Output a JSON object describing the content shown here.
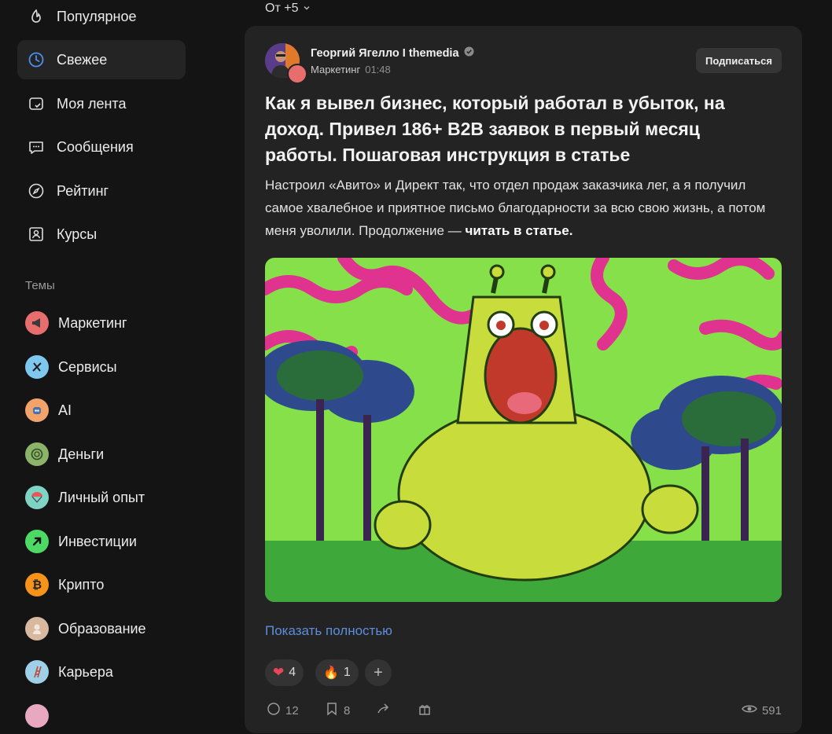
{
  "nav": [
    {
      "label": "Популярное",
      "icon": "fire-icon",
      "active": false
    },
    {
      "label": "Свежее",
      "icon": "clock-icon",
      "active": true
    },
    {
      "label": "Моя лента",
      "icon": "feed-icon",
      "active": false
    },
    {
      "label": "Сообщения",
      "icon": "chat-icon",
      "active": false
    },
    {
      "label": "Рейтинг",
      "icon": "compass-icon",
      "active": false
    },
    {
      "label": "Курсы",
      "icon": "courses-icon",
      "active": false
    }
  ],
  "topics_heading": "Темы",
  "topics": [
    {
      "label": "Маркетинг",
      "color": "#e86d6d"
    },
    {
      "label": "Сервисы",
      "color": "#7ec8f0"
    },
    {
      "label": "AI",
      "color": "#f2a36b"
    },
    {
      "label": "Деньги",
      "color": "#8bb46a"
    },
    {
      "label": "Личный опыт",
      "color": "#7fd3c4"
    },
    {
      "label": "Инвестиции",
      "color": "#4cd964"
    },
    {
      "label": "Крипто",
      "color": "#f7931a"
    },
    {
      "label": "Образование",
      "color": "#d9b8a0"
    },
    {
      "label": "Карьера",
      "color": "#9fd0e8"
    }
  ],
  "filter_label": "От +5",
  "post": {
    "author": "Георгий Ягелло I themedia",
    "category": "Маркетинг",
    "time": "01:48",
    "subscribe_label": "Подписаться",
    "title": "Как я вывел бизнес, который работал в убыток, на доход. Привел 186+ B2B заявок в первый месяц работы. Пошаговая инструкция в статье",
    "lead": "Настроил «Авито» и Директ так, что отдел продаж заказчика лег, а я получил самое хвалебное и приятное письмо благодарности за всю свою жизнь, а потом меня уволили. Продолжение — ",
    "lead_bold": "читать в статье.",
    "show_more": "Показать полностью",
    "reactions": [
      {
        "emoji": "❤",
        "count": "4"
      },
      {
        "emoji": "🔥",
        "count": "1"
      }
    ],
    "add_reaction": "+",
    "comments": "12",
    "bookmarks": "8",
    "views": "591"
  }
}
